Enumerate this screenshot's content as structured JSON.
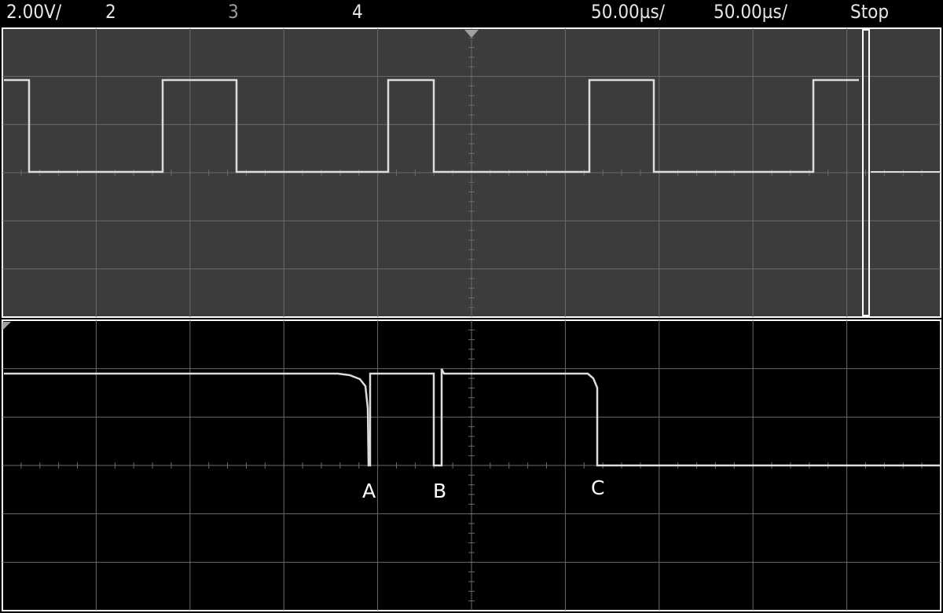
{
  "status_bar": {
    "ch1_scale": "2.00V/",
    "ch2_label": "2",
    "ch3_label": "3",
    "ch4_label": "4",
    "timebase_main": "50.00µs/",
    "timebase_zoom": "50.00µs/",
    "run_state": "Stop"
  },
  "markers": {
    "a": "A",
    "b": "B",
    "c": "C"
  },
  "colors": {
    "main_background": "#3c3c3c",
    "zoom_background": "#000000",
    "grid": "#6a6a6a",
    "trace": "#dcdcdc",
    "border": "#ffffff"
  }
}
